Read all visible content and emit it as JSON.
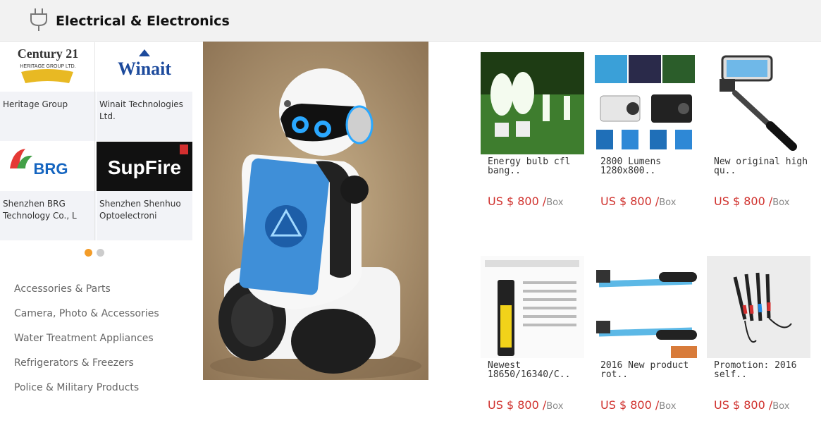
{
  "header": {
    "title": "Electrical & Electronics",
    "chevron": "›",
    "icon": "plug-icon"
  },
  "brands": [
    {
      "name": "Heritage Group",
      "logo_text": "Century 21",
      "logo_sub": "HERITAGE GROUP LTD."
    },
    {
      "name": "Winait Technologies Ltd.",
      "logo_text": "Winait"
    },
    {
      "name": "Shenzhen BRG Technology Co., L",
      "logo_text": "BRG"
    },
    {
      "name": "Shenzhen Shenhuo Optoelectroni",
      "logo_text": "SupFire"
    }
  ],
  "carousel": {
    "count": 2,
    "active": 0
  },
  "categories": [
    "Accessories & Parts",
    "Camera, Photo & Accessories",
    "Water Treatment Appliances",
    "Refrigerators & Freezers",
    "Police & Military Products"
  ],
  "products": [
    {
      "title": "Energy bulb cfl bang..",
      "price": "US $ 800 /",
      "unit": "Box"
    },
    {
      "title": "2800 Lumens 1280x800..",
      "price": "US $ 800 /",
      "unit": "Box"
    },
    {
      "title": "New original high qu..",
      "price": "US $ 800 /",
      "unit": "Box"
    },
    {
      "title": "Newest 18650/16340/C..",
      "price": "US $ 800 /",
      "unit": "Box"
    },
    {
      "title": "2016 New product rot..",
      "price": "US $ 800 /",
      "unit": "Box"
    },
    {
      "title": "Promotion: 2016 self..",
      "price": "US $ 800 /",
      "unit": "Box"
    }
  ],
  "colors": {
    "accent": "#f39c28",
    "price": "#d0312d",
    "header_bg": "#f2f2f2"
  }
}
